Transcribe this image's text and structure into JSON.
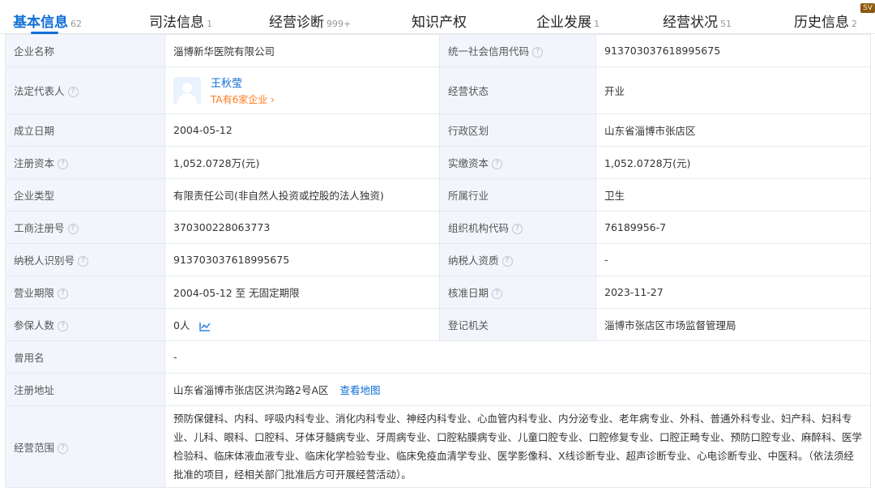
{
  "tabs": [
    {
      "label": "基本信息",
      "count": "62",
      "active": true
    },
    {
      "label": "司法信息",
      "count": "1"
    },
    {
      "label": "经营诊断",
      "count": "999+"
    },
    {
      "label": "知识产权",
      "count": ""
    },
    {
      "label": "企业发展",
      "count": "1"
    },
    {
      "label": "经营状况",
      "count": "51"
    },
    {
      "label": "历史信息",
      "count": "2"
    }
  ],
  "svip_badge": "SV",
  "colors": {
    "accent": "#0f6fd6",
    "label_bg": "#f2f6fc",
    "orange": "#ff7a1a"
  },
  "info": {
    "company_name_label": "企业名称",
    "company_name": "淄博新华医院有限公司",
    "credit_code_label": "统一社会信用代码",
    "credit_code": "913703037618995675",
    "legal_rep_label": "法定代表人",
    "legal_rep_name": "王秋莹",
    "legal_rep_sub": "TA有6家企业 ›",
    "status_label": "经营状态",
    "status": "开业",
    "founded_label": "成立日期",
    "founded": "2004-05-12",
    "region_label": "行政区划",
    "region": "山东省淄博市张店区",
    "reg_capital_label": "注册资本",
    "reg_capital": "1,052.0728万(元)",
    "paid_capital_label": "实缴资本",
    "paid_capital": "1,052.0728万(元)",
    "type_label": "企业类型",
    "type": "有限责任公司(非自然人投资或控股的法人独资)",
    "industry_label": "所属行业",
    "industry": "卫生",
    "reg_no_label": "工商注册号",
    "reg_no": "370300228063773",
    "org_code_label": "组织机构代码",
    "org_code": "76189956-7",
    "taxpayer_id_label": "纳税人识别号",
    "taxpayer_id": "913703037618995675",
    "taxpayer_qual_label": "纳税人资质",
    "taxpayer_qual": "-",
    "term_label": "营业期限",
    "term": "2004-05-12 至 无固定期限",
    "approve_date_label": "核准日期",
    "approve_date": "2023-11-27",
    "insured_label": "参保人数",
    "insured": "0人",
    "authority_label": "登记机关",
    "authority": "淄博市张店区市场监督管理局",
    "former_name_label": "曾用名",
    "former_name": "-",
    "address_label": "注册地址",
    "address": "山东省淄博市张店区洪沟路2号A区",
    "map_link": "查看地图",
    "scope_label": "经营范围",
    "scope": "预防保健科、内科、呼吸内科专业、消化内科专业、神经内科专业、心血管内科专业、内分泌专业、老年病专业、外科、普通外科专业、妇产科、妇科专业、儿科、眼科、口腔科、牙体牙髓病专业、牙周病专业、口腔粘膜病专业、儿童口腔专业、口腔修复专业、口腔正畸专业、预防口腔专业、麻醉科、医学检验科、临床体液血液专业、临床化学检验专业、临床免疫血清学专业、医学影像科、X线诊断专业、超声诊断专业、心电诊断专业、中医科。（依法须经批准的项目，经相关部门批准后方可开展经营活动）。"
  }
}
